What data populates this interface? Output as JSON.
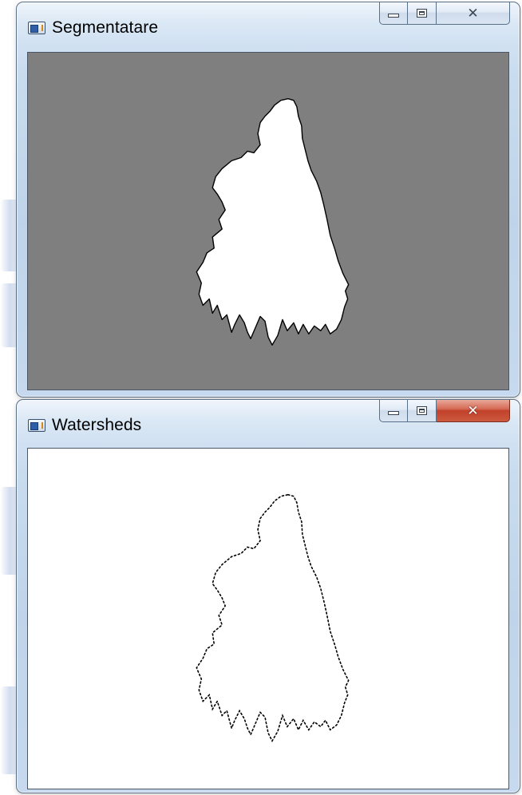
{
  "windows": [
    {
      "id": "segmentation",
      "title": "Segmentatare",
      "active": false,
      "controls": {
        "minimize": "minimize",
        "maximize": "maximize",
        "close": "close"
      },
      "content": {
        "background": "#7f7f7f",
        "region_fill": "#ffffff",
        "region_outline": "#000000"
      }
    },
    {
      "id": "watersheds",
      "title": "Watersheds",
      "active": true,
      "controls": {
        "minimize": "minimize",
        "maximize": "maximize",
        "close": "close"
      },
      "content": {
        "background": "#ffffff",
        "region_fill": "none",
        "region_outline": "#000000"
      }
    }
  ],
  "icons": {
    "app_icon": "window-app-icon",
    "minimize": "minimize-icon",
    "maximize": "maximize-icon",
    "close": "close-icon"
  },
  "colors": {
    "close_active": "#c2412a",
    "titlebar": "#c9dcef"
  }
}
